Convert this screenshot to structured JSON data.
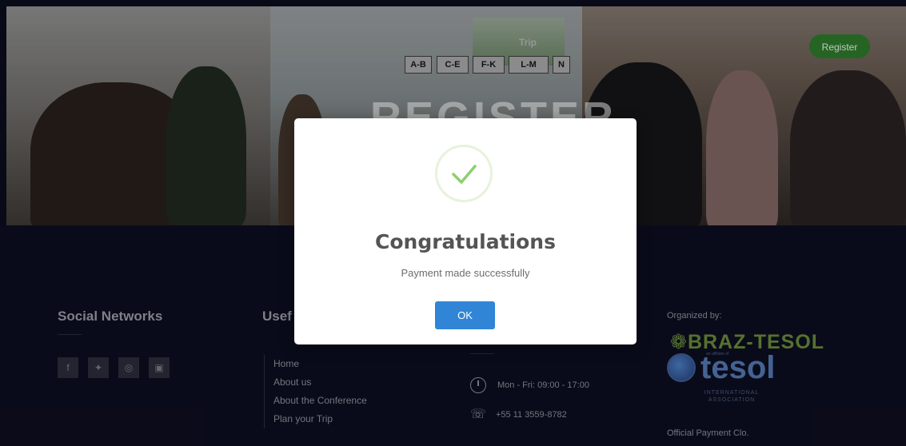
{
  "hero": {
    "title": "REGISTER",
    "register_label": "Register",
    "booth_sign": "Trip",
    "shelf_signs": [
      "A-B",
      "C-E",
      "F-K",
      "L-M",
      "N"
    ]
  },
  "footer": {
    "social_title": "Social Networks",
    "social_icons": [
      "facebook-icon",
      "twitter-icon",
      "instagram-icon",
      "linkedin-icon"
    ],
    "useful_title": "Usef",
    "links": [
      "Home",
      "About us",
      "About the Conference",
      "Plan your Trip"
    ],
    "contact": {
      "hours": "Mon - Fri: 09:00 - 17:00",
      "phone": "+55 11 3559-8782"
    },
    "organized_by": "Organized by:",
    "braz_tesol": "BRAZ-TESOL",
    "tesol": "tesol",
    "tesol_sub": "INTERNATIONAL ASSOCIATION",
    "affiliate": "an affiliate of",
    "official_payment": "Official Payment Clo."
  },
  "modal": {
    "title": "Congratulations",
    "message": "Payment made successfully",
    "ok_label": "OK",
    "check_color": "#8cd06e"
  }
}
